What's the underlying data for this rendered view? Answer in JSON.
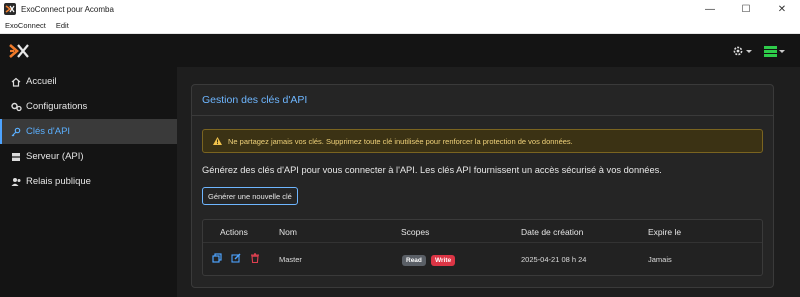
{
  "window": {
    "title": "ExoConnect pour Acomba",
    "controls": [
      "—",
      "☐",
      "✕"
    ]
  },
  "menu": [
    "ExoConnect",
    "Edit"
  ],
  "sidebar": {
    "items": [
      {
        "label": "Accueil",
        "icon": "home-icon"
      },
      {
        "label": "Configurations",
        "icon": "gears-icon"
      },
      {
        "label": "Clés d'API",
        "icon": "key-icon",
        "active": true
      },
      {
        "label": "Serveur (API)",
        "icon": "server-icon"
      },
      {
        "label": "Relais publique",
        "icon": "users-icon"
      }
    ]
  },
  "card": {
    "title": "Gestion des clés d'API",
    "alert": "Ne partagez jamais vos clés. Supprimez toute clé inutilisée pour renforcer la protection de vos données.",
    "description": "Générez des clés d'API pour vous connecter à l'API. Les clés API fournissent un accès sécurisé à vos données.",
    "generate_label": "Générer une nouvelle clé"
  },
  "table": {
    "headers": [
      "Actions",
      "Nom",
      "Scopes",
      "Date de création",
      "Expire le"
    ],
    "rows": [
      {
        "name": "Master",
        "scopes": [
          "Read",
          "Write"
        ],
        "created": "2025-04-21 08 h 24",
        "expires": "Jamais"
      }
    ]
  },
  "colors": {
    "accent": "#6eb6ff",
    "read_badge": "#5a5f66",
    "write_badge": "#dc3545",
    "warning": "#f0c24b",
    "danger_icon": "#e04050"
  }
}
